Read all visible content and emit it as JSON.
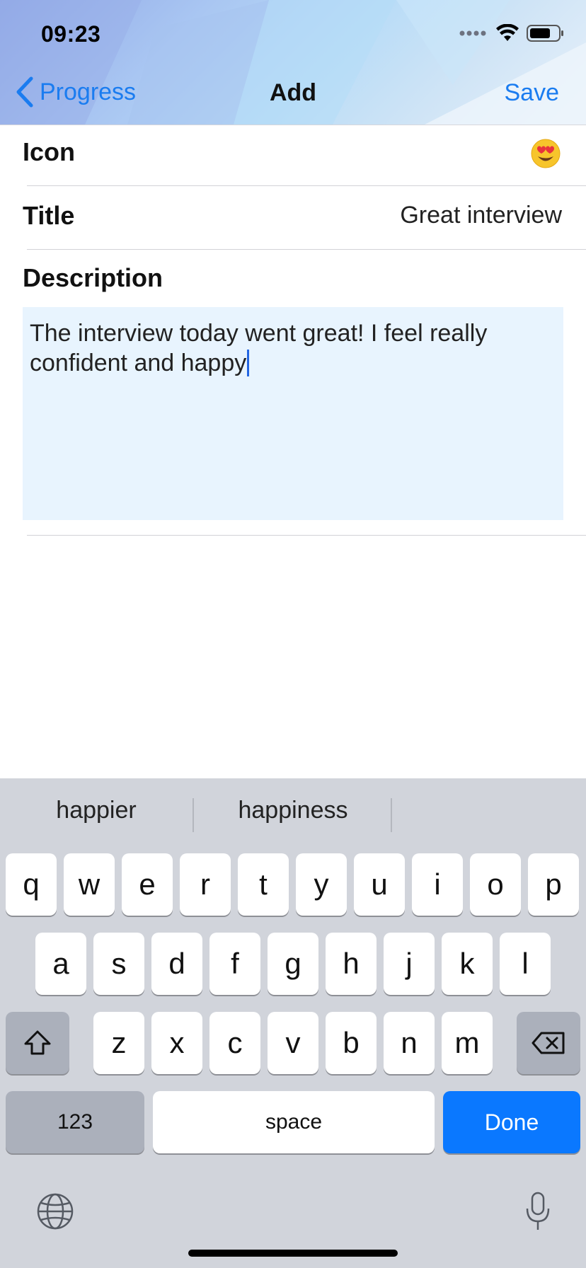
{
  "status_bar": {
    "time": "09:23"
  },
  "nav": {
    "back_label": "Progress",
    "title": "Add",
    "save_label": "Save"
  },
  "form": {
    "icon_label": "Icon",
    "icon_value": "heart-eyes-emoji",
    "title_label": "Title",
    "title_value": "Great interview",
    "description_label": "Description",
    "description_value": "The interview today went great! I feel really confident and happy"
  },
  "keyboard": {
    "suggestions": [
      "happier",
      "happiness",
      ""
    ],
    "row1": [
      "q",
      "w",
      "e",
      "r",
      "t",
      "y",
      "u",
      "i",
      "o",
      "p"
    ],
    "row2": [
      "a",
      "s",
      "d",
      "f",
      "g",
      "h",
      "j",
      "k",
      "l"
    ],
    "row3": [
      "z",
      "x",
      "c",
      "v",
      "b",
      "n",
      "m"
    ],
    "numbers_label": "123",
    "space_label": "space",
    "done_label": "Done"
  },
  "colors": {
    "accent": "#1a7cf0",
    "done_key": "#0a78ff",
    "text_area": "#e8f4fe",
    "keyboard_bg": "#d1d4db"
  }
}
